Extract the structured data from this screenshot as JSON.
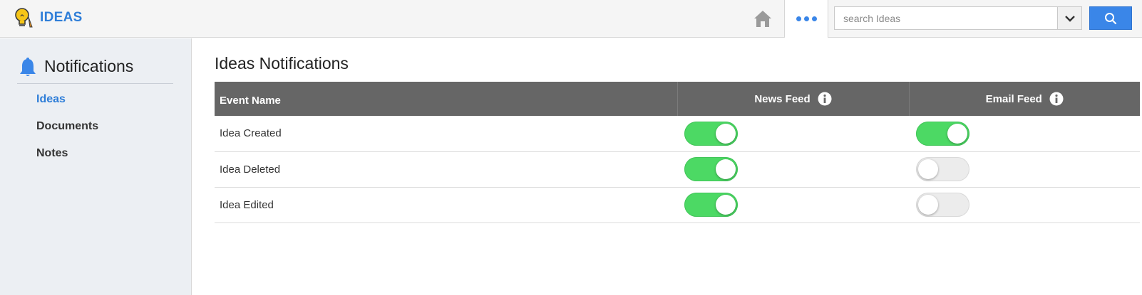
{
  "app": {
    "name": "IDEAS"
  },
  "header": {
    "search_placeholder": "search Ideas",
    "icons": {
      "home": "home-icon",
      "more": "more-icon",
      "dropdown": "chevron-down-icon",
      "search": "search-icon"
    }
  },
  "sidebar": {
    "title": "Notifications",
    "items": [
      {
        "label": "Ideas",
        "active": true
      },
      {
        "label": "Documents",
        "active": false
      },
      {
        "label": "Notes",
        "active": false
      }
    ]
  },
  "main": {
    "title": "Ideas Notifications",
    "columns": [
      "Event Name",
      "News Feed",
      "Email Feed"
    ],
    "rows": [
      {
        "event": "Idea Created",
        "news_feed": true,
        "email_feed": true
      },
      {
        "event": "Idea Deleted",
        "news_feed": true,
        "email_feed": false
      },
      {
        "event": "Idea Edited",
        "news_feed": true,
        "email_feed": false
      }
    ]
  },
  "colors": {
    "accent": "#3a86e8",
    "brand": "#2f7ed8",
    "toggle_on": "#4cd964",
    "header_bg": "#666666"
  }
}
